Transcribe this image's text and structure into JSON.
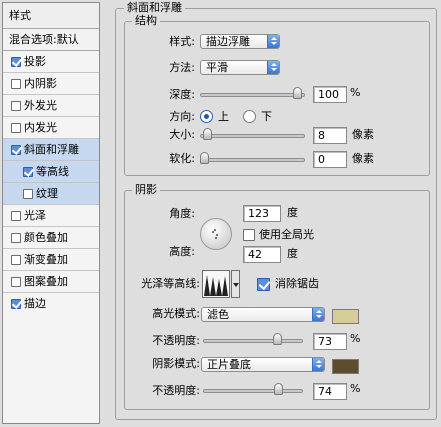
{
  "sidebar": {
    "header": "样式",
    "blend_options": "混合选项:默认",
    "items": [
      {
        "label": "投影",
        "checked": true
      },
      {
        "label": "内阴影",
        "checked": false
      },
      {
        "label": "外发光",
        "checked": false
      },
      {
        "label": "内发光",
        "checked": false
      },
      {
        "label": "斜面和浮雕",
        "checked": true
      },
      {
        "label": "等高线",
        "checked": true
      },
      {
        "label": "纹理",
        "checked": false
      },
      {
        "label": "光泽",
        "checked": false
      },
      {
        "label": "颜色叠加",
        "checked": false
      },
      {
        "label": "渐变叠加",
        "checked": false
      },
      {
        "label": "图案叠加",
        "checked": false
      },
      {
        "label": "描边",
        "checked": true
      }
    ]
  },
  "bevel": {
    "title": "斜面和浮雕",
    "structure": {
      "title": "结构",
      "style_label": "样式:",
      "style_value": "描边浮雕",
      "method_label": "方法:",
      "method_value": "平滑",
      "depth_label": "深度:",
      "depth_value": "100",
      "depth_unit": "%",
      "depth_level": 1.0,
      "direction_label": "方向:",
      "direction_up": "上",
      "direction_down": "下",
      "direction_selected": "上",
      "size_label": "大小:",
      "size_value": "8",
      "size_unit": "像素",
      "soften_label": "软化:",
      "soften_value": "0",
      "soften_unit": "像素"
    },
    "shading": {
      "title": "阴影",
      "angle_label": "角度:",
      "angle_value": "123",
      "angle_unit": "度",
      "global_light_label": "使用全局光",
      "global_light_checked": false,
      "altitude_label": "高度:",
      "altitude_value": "42",
      "altitude_unit": "度",
      "gloss_contour_label": "光泽等高线:",
      "antialias_label": "消除锯齿",
      "antialias_checked": true,
      "highlight_mode_label": "高光模式:",
      "highlight_mode_value": "滤色",
      "highlight_color": "#d6cd9a",
      "highlight_opacity_label": "不透明度:",
      "highlight_opacity_value": "73",
      "highlight_opacity_unit": "%",
      "shadow_mode_label": "阴影模式:",
      "shadow_mode_value": "正片叠底",
      "shadow_color": "#5b4d2e",
      "shadow_opacity_label": "不透明度:",
      "shadow_opacity_value": "74",
      "shadow_opacity_unit": "%"
    }
  }
}
